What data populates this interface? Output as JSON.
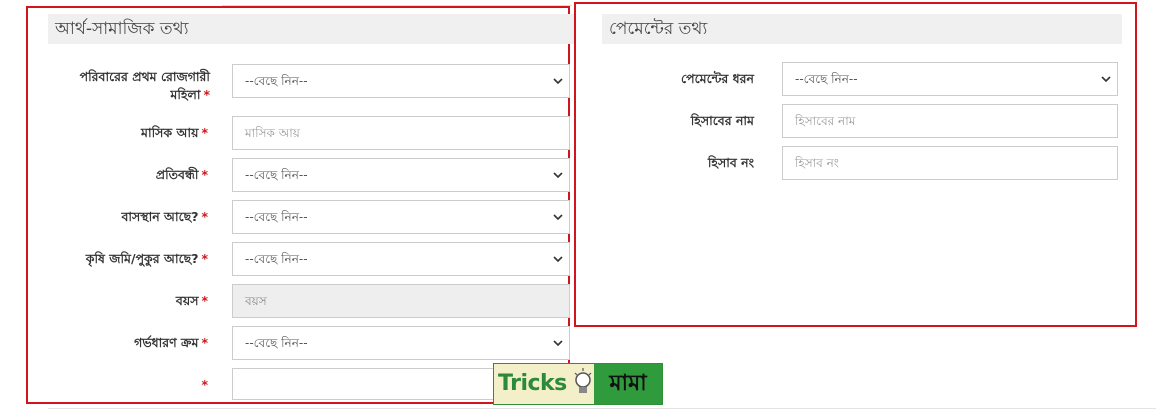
{
  "left_section": {
    "title": "আর্থ-সামাজিক তথ্য",
    "fields": [
      {
        "label_line1": "পরিবারের প্রথম রোজগারী",
        "label_line2": "মহিলা",
        "required": "*",
        "type": "select",
        "value": "--বেছে নিন--"
      },
      {
        "label": "মাসিক আয়",
        "required": "*",
        "type": "input",
        "placeholder": "মাসিক আয়"
      },
      {
        "label": "প্রতিবন্ধী",
        "required": "*",
        "type": "select",
        "value": "--বেছে নিন--"
      },
      {
        "label": "বাসস্থান আছে?",
        "required": "*",
        "type": "select",
        "value": "--বেছে নিন--"
      },
      {
        "label": "কৃষি জমি/পুকুর আছে?",
        "required": "*",
        "type": "select",
        "value": "--বেছে নিন--"
      },
      {
        "label": "বয়স",
        "required": "*",
        "type": "input-disabled",
        "placeholder": "বয়স"
      },
      {
        "label": "গর্ভধারণ ক্রম",
        "required": "*",
        "type": "select",
        "value": "--বেছে নিন--"
      },
      {
        "label": "",
        "required": "*",
        "type": "input",
        "placeholder": ""
      }
    ]
  },
  "right_section": {
    "title": "পেমেন্টের তথ্য",
    "fields": [
      {
        "label": "পেমেন্টের ধরন",
        "type": "select",
        "value": "--বেছে নিন--"
      },
      {
        "label": "হিসাবের নাম",
        "type": "input",
        "placeholder": "হিসাবের নাম"
      },
      {
        "label": "হিসাব নং",
        "type": "input",
        "placeholder": "হিসাব নং"
      }
    ]
  },
  "watermark": {
    "left_text": "Tricks",
    "right_text": "মামা"
  },
  "colors": {
    "highlight_border": "#d0161c",
    "header_bg": "#f0f0f0",
    "required": "#d0161c"
  },
  "icons": {
    "select": "chevron-down-icon",
    "logo": "lightbulb-icon"
  }
}
